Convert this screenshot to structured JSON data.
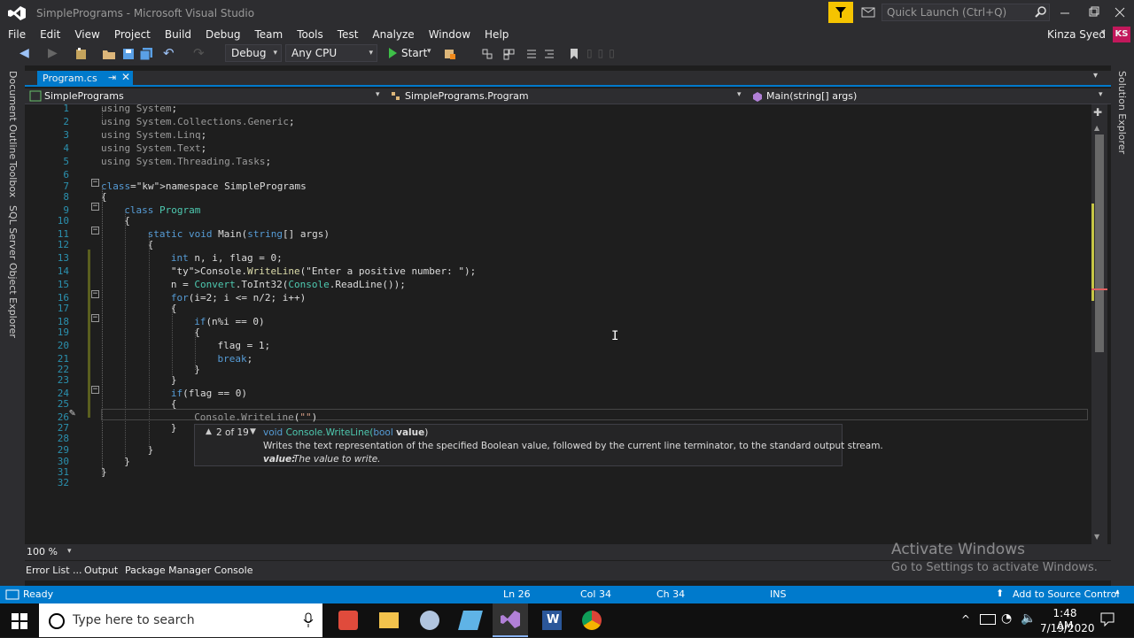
{
  "app": {
    "title": "SimplePrograms - Microsoft Visual Studio",
    "quick_launch_placeholder": "Quick Launch (Ctrl+Q)",
    "user_name": "Kinza Syed",
    "user_initials": "KS"
  },
  "menu": [
    "File",
    "Edit",
    "View",
    "Project",
    "Build",
    "Debug",
    "Team",
    "Tools",
    "Test",
    "Analyze",
    "Window",
    "Help"
  ],
  "toolbar": {
    "config": "Debug",
    "platform": "Any CPU",
    "start_label": "Start"
  },
  "left_panels": [
    "Document Outline",
    "Toolbox",
    "SQL Server Object Explorer"
  ],
  "right_panels": [
    "Solution Explorer"
  ],
  "tab": {
    "label": "Program.cs"
  },
  "nav": {
    "project": "SimplePrograms",
    "class": "SimplePrograms.Program",
    "member": "Main(string[] args)"
  },
  "code": {
    "lines": [
      {
        "n": "1",
        "t": "using System;"
      },
      {
        "n": "2",
        "t": "using System.Collections.Generic;"
      },
      {
        "n": "3",
        "t": "using System.Linq;"
      },
      {
        "n": "4",
        "t": "using System.Text;"
      },
      {
        "n": "5",
        "t": "using System.Threading.Tasks;"
      },
      {
        "n": "6",
        "t": ""
      },
      {
        "n": "7",
        "t": "namespace SimplePrograms"
      },
      {
        "n": "8",
        "t": "{"
      },
      {
        "n": "9",
        "t": "class Program"
      },
      {
        "n": "10",
        "t": "{"
      },
      {
        "n": "11",
        "t": "static void Main(string[] args)"
      },
      {
        "n": "12",
        "t": "{"
      },
      {
        "n": "13",
        "t": "int n, i, flag = 0;"
      },
      {
        "n": "14",
        "t": "Console.WriteLine(\"Enter a positive number: \");"
      },
      {
        "n": "15",
        "t": "n = Convert.ToInt32(Console.ReadLine());"
      },
      {
        "n": "16",
        "t": "for(i=2; i <= n/2; i++)"
      },
      {
        "n": "17",
        "t": "{"
      },
      {
        "n": "18",
        "t": "if(n%i == 0)"
      },
      {
        "n": "19",
        "t": "{"
      },
      {
        "n": "20",
        "t": "flag = 1;"
      },
      {
        "n": "21",
        "t": "break;"
      },
      {
        "n": "22",
        "t": "}"
      },
      {
        "n": "23",
        "t": "}"
      },
      {
        "n": "24",
        "t": "if(flag == 0)"
      },
      {
        "n": "25",
        "t": "{"
      },
      {
        "n": "26",
        "t": "Console.WriteLine(\"\")"
      },
      {
        "n": "27",
        "t": "}"
      },
      {
        "n": "28",
        "t": ""
      },
      {
        "n": "29",
        "t": "}"
      },
      {
        "n": "30",
        "t": "}"
      },
      {
        "n": "31",
        "t": "}"
      },
      {
        "n": "32",
        "t": ""
      }
    ]
  },
  "tooltip": {
    "counter": "2 of 19",
    "signature_void": "void",
    "signature_class": "Console.WriteLine(",
    "signature_param_type": "bool",
    "signature_param_name": "value",
    "signature_end": ")",
    "description": "Writes the text representation of the specified Boolean value, followed by the current line terminator, to the standard output stream.",
    "param_label": "value:",
    "param_desc": "The value to write."
  },
  "zoom": "100 %",
  "tool_tabs": [
    "Error List ...",
    "Output",
    "Package Manager Console"
  ],
  "watermark": {
    "title": "Activate Windows",
    "sub": "Go to Settings to activate Windows."
  },
  "status": {
    "state": "Ready",
    "ln": "Ln 26",
    "col": "Col 34",
    "ch": "Ch 34",
    "ins": "INS",
    "source_control": "Add to Source Control"
  },
  "taskbar": {
    "search_placeholder": "Type here to search",
    "time": "1:48 AM",
    "date": "7/19/2020"
  },
  "colors": {
    "accent": "#007acc",
    "keyword": "#569cd6",
    "type": "#4ec9b0",
    "string": "#d69d85",
    "line_number": "#2b91af"
  }
}
